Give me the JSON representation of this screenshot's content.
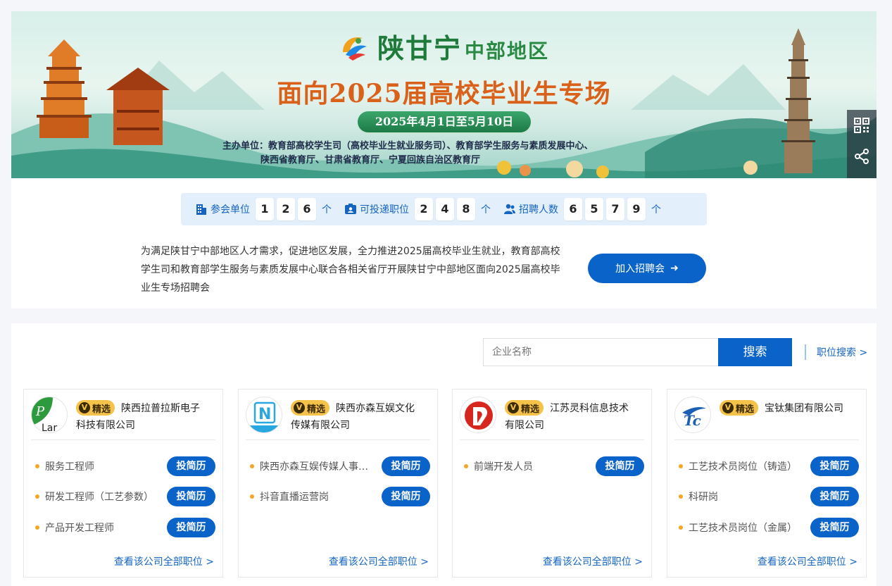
{
  "banner": {
    "brand_main": "陕甘宁",
    "brand_sub": "中部地区",
    "headline": "面向2025届高校毕业生专场",
    "date_range": "2025年4月1日至5月10日",
    "organizer_line1": "主办单位：教育部高校学生司（高校毕业生就业服务司）、教育部学生服务与素质发展中心、",
    "organizer_line2": "陕西省教育厅、甘肃省教育厅、宁夏回族自治区教育厅",
    "side_tools": [
      "qrcode-icon",
      "share-icon"
    ]
  },
  "stats": {
    "units": {
      "label": "参会单位",
      "digits": [
        "1",
        "2",
        "6"
      ],
      "unit": "个",
      "icon": "building-icon"
    },
    "positions": {
      "label": "可投递职位",
      "digits": [
        "2",
        "4",
        "8"
      ],
      "unit": "个",
      "icon": "id-card-icon"
    },
    "hires": {
      "label": "招聘人数",
      "digits": [
        "6",
        "5",
        "7",
        "9"
      ],
      "unit": "个",
      "icon": "people-icon"
    }
  },
  "intro": {
    "text": "为满足陕甘宁中部地区人才需求，促进地区发展，全力推进2025届高校毕业生就业，教育部高校学生司和教育部学生服务与素质发展中心联合各相关省厅开展陕甘宁中部地区面向2025届高校毕业生专场招聘会",
    "join_label": "加入招聘会",
    "join_arrow": "➜"
  },
  "search": {
    "placeholder": "企业名称",
    "button_label": "搜索",
    "job_search_link": "职位搜索 >"
  },
  "badge_label": "精选",
  "badge_mark": "V",
  "companies": [
    {
      "name": "陕西拉普拉斯电子科技有限公司",
      "logo": "laplace-logo",
      "jobs": [
        "服务工程师",
        "研发工程师（工艺参数）",
        "产品开发工程师"
      ],
      "apply_label": "投简历",
      "view_all": "查看该公司全部职位 >"
    },
    {
      "name": "陕西亦森互娱文化传媒有限公司",
      "logo": "yisen-logo",
      "jobs": [
        "陕西亦森互娱传媒人事专员",
        "抖音直播运营岗"
      ],
      "apply_label": "投简历",
      "view_all": "查看该公司全部职位 >"
    },
    {
      "name": "江苏灵科信息技术有限公司",
      "logo": "lingke-logo",
      "jobs": [
        "前端开发人员"
      ],
      "apply_label": "投简历",
      "view_all": "查看该公司全部职位 >"
    },
    {
      "name": "宝钛集团有限公司",
      "logo": "baoti-logo",
      "jobs": [
        "工艺技术员岗位（铸造）",
        "科研岗",
        "工艺技术员岗位（金属）"
      ],
      "apply_label": "投简历",
      "view_all": "查看该公司全部职位 >"
    }
  ],
  "colors": {
    "primary": "#0a63c9",
    "stats_bg": "#e3f0fc",
    "badge": "#f5c24a",
    "job_dot": "#f5a623",
    "headline": "#d9611a",
    "brand": "#1f7a3b"
  }
}
